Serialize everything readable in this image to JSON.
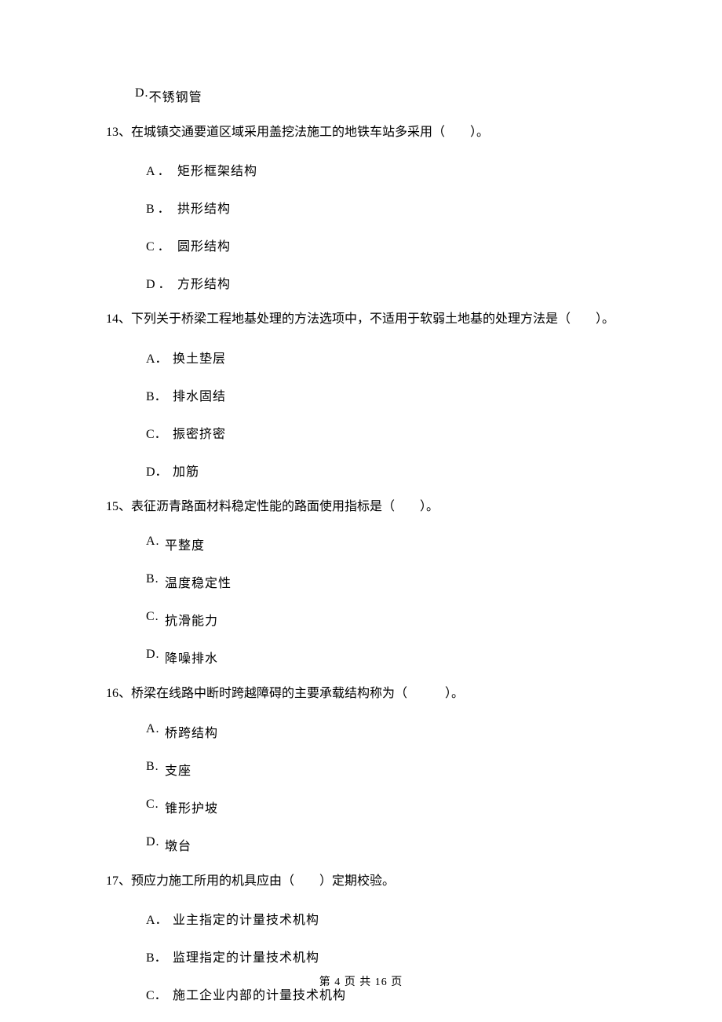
{
  "q12_optD_letter": "D.",
  "q12_optD_text": "不锈钢管",
  "q13_num": "13、",
  "q13_text": "在城镇交通要道区域采用盖挖法施工的地铁车站多采用（　　）。",
  "q13_A_letter": "A ．",
  "q13_A_text": "矩形框架结构",
  "q13_B_letter": "B ．",
  "q13_B_text": "拱形结构",
  "q13_C_letter": "C ．",
  "q13_C_text": "圆形结构",
  "q13_D_letter": "D ．",
  "q13_D_text": "方形结构",
  "q14_num": "14、",
  "q14_text": "下列关于桥梁工程地基处理的方法选项中，不适用于软弱土地基的处理方法是（　　）。",
  "q14_A_letter": "A．",
  "q14_A_text": "换土垫层",
  "q14_B_letter": "B．",
  "q14_B_text": "排水固结",
  "q14_C_letter": "C．",
  "q14_C_text": "振密挤密",
  "q14_D_letter": "D．",
  "q14_D_text": "加筋",
  "q15_num": "15、",
  "q15_text": "表征沥青路面材料稳定性能的路面使用指标是（　　）。",
  "q15_A_letter": "A.",
  "q15_A_text": "平整度",
  "q15_B_letter": "B.",
  "q15_B_text": "温度稳定性",
  "q15_C_letter": "C.",
  "q15_C_text": "抗滑能力",
  "q15_D_letter": "D.",
  "q15_D_text": "降噪排水",
  "q16_num": "16、",
  "q16_text": "桥梁在线路中断时跨越障碍的主要承载结构称为（　　　）。",
  "q16_A_letter": "A.",
  "q16_A_text": "桥跨结构",
  "q16_B_letter": "B.",
  "q16_B_text": "支座",
  "q16_C_letter": "C.",
  "q16_C_text": "锥形护坡",
  "q16_D_letter": "D.",
  "q16_D_text": "墩台",
  "q17_num": "17、",
  "q17_text": "预应力施工所用的机具应由（　　）定期校验。",
  "q17_A_letter": "A．",
  "q17_A_text": "业主指定的计量技术机构",
  "q17_B_letter": "B．",
  "q17_B_text": "监理指定的计量技术机构",
  "q17_C_letter": "C．",
  "q17_C_text": "施工企业内部的计量技术机构",
  "footer": "第 4 页 共 16 页"
}
